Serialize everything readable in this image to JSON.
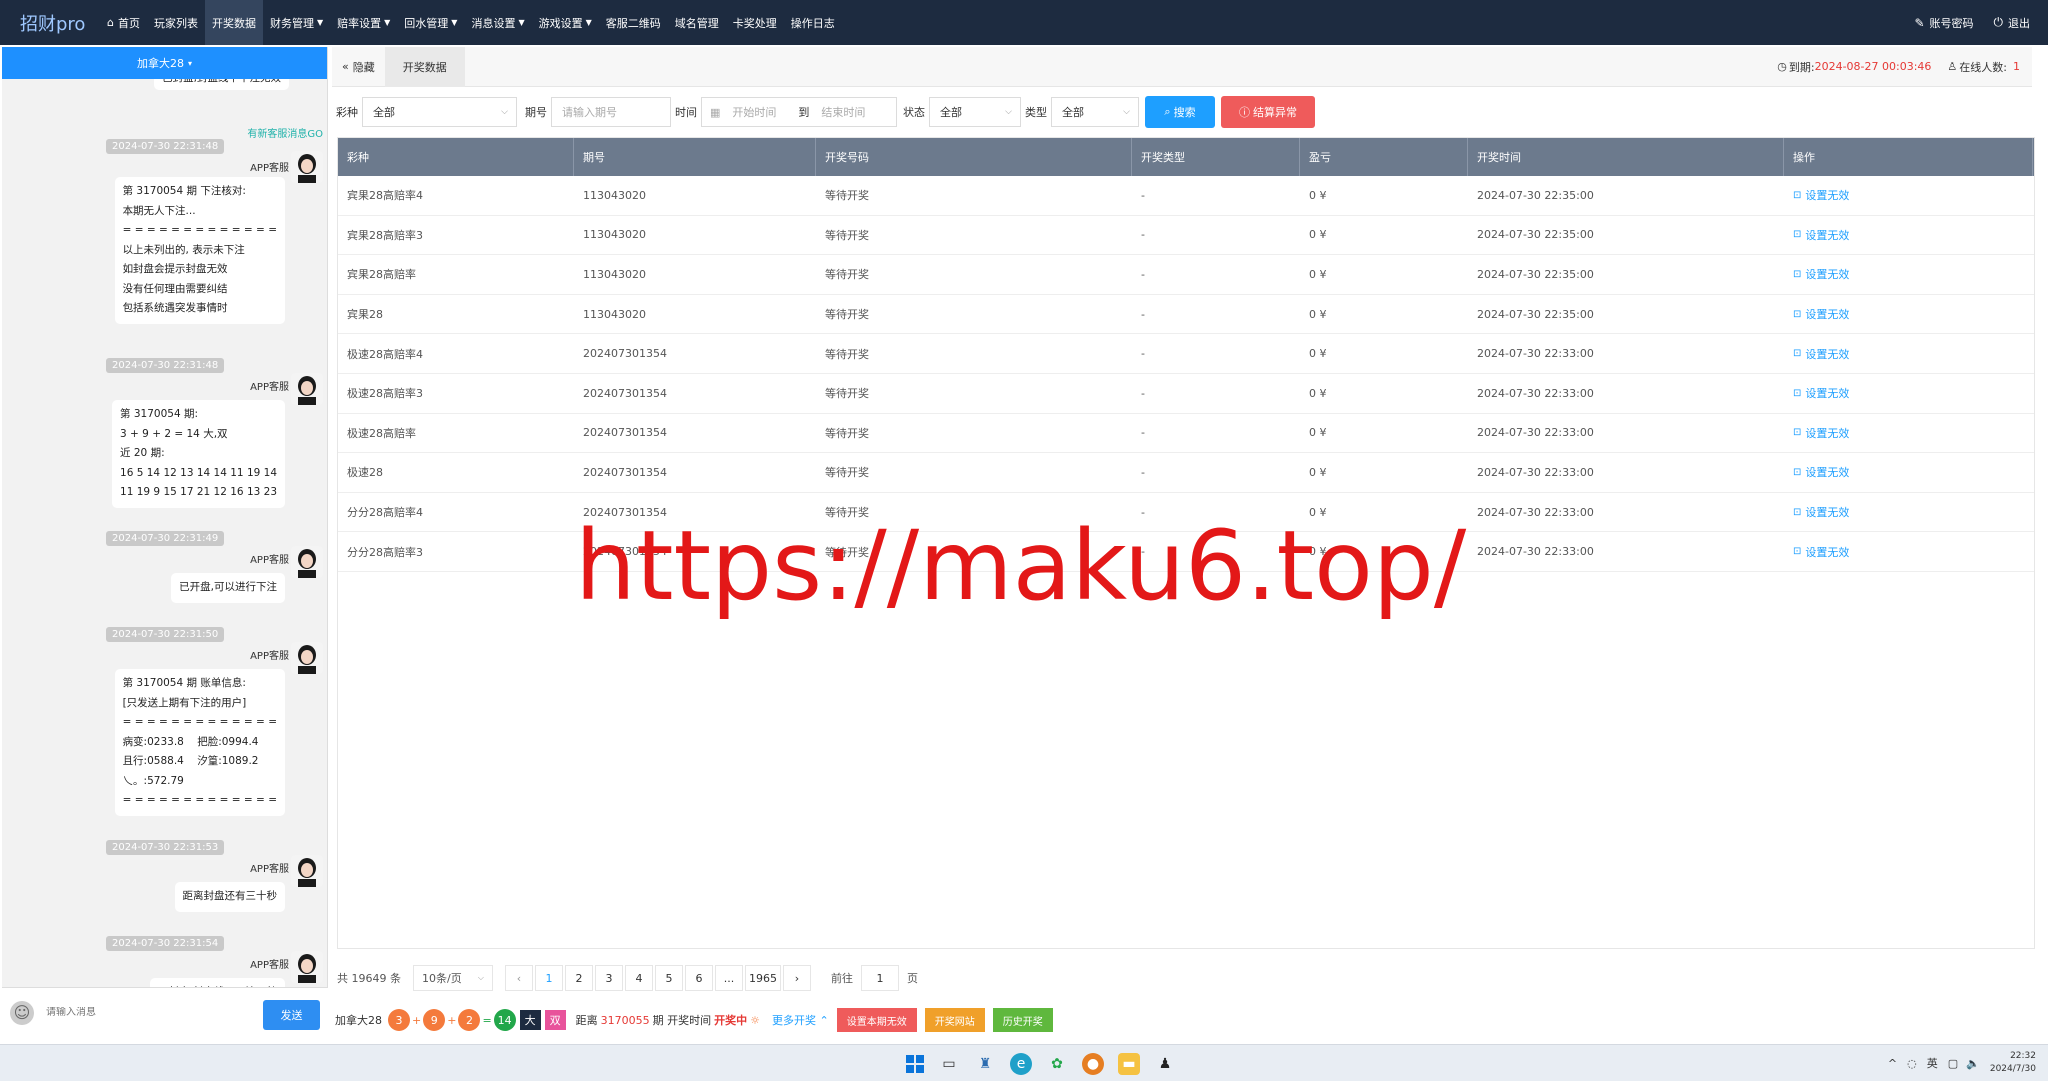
{
  "app": {
    "brand": "招财pro"
  },
  "nav": [
    {
      "label": "首页",
      "icon": "home-icon",
      "caret": false,
      "active": false
    },
    {
      "label": "玩家列表",
      "caret": false,
      "active": false
    },
    {
      "label": "开奖数据",
      "caret": false,
      "active": true
    },
    {
      "label": "财务管理",
      "caret": true,
      "active": false
    },
    {
      "label": "赔率设置",
      "caret": true,
      "active": false
    },
    {
      "label": "回水管理",
      "caret": true,
      "active": false
    },
    {
      "label": "消息设置",
      "caret": true,
      "active": false
    },
    {
      "label": "游戏设置",
      "caret": true,
      "active": false
    },
    {
      "label": "客服二维码",
      "caret": false,
      "active": false
    },
    {
      "label": "域名管理",
      "caret": false,
      "active": false
    },
    {
      "label": "卡奖处理",
      "caret": false,
      "active": false
    },
    {
      "label": "操作日志",
      "caret": false,
      "active": false
    }
  ],
  "top_right": {
    "password_label": "账号密码",
    "logout_label": "退出"
  },
  "chat": {
    "header": "加拿大28",
    "top_partial": "已封盘,封盘线下下注无效",
    "notice": "有新客服消息GO",
    "messages": [
      {
        "time": "2024-07-30 22:31:48",
        "sender": "APP客服",
        "text": "第 3170054 期 下注核对:\n本期无人下注...\n= = = = = = = = = = = = =\n以上未列出的, 表示未下注\n如封盘会提示封盘无效\n没有任何理由需要纠结\n包括系统遇突发事情时"
      },
      {
        "time": "2024-07-30 22:31:48",
        "sender": "APP客服",
        "text": "第 3170054 期:\n3 + 9 + 2 = 14 大,双\n近 20 期:\n16 5 14 12 13 14 14 11 19 14\n11 19 9 15 17 21 12 16 13 23"
      },
      {
        "time": "2024-07-30 22:31:49",
        "sender": "APP客服",
        "text": "已开盘,可以进行下注"
      },
      {
        "time": "2024-07-30 22:31:50",
        "sender": "APP客服",
        "text": "第 3170054 期 账单信息:\n[只发送上期有下注的用户]\n= = = = = = = = = = = = =\n病变:0233.8    把脸:0994.4\n且行:0588.4    汐篁:1089.2\n乀。:572.79\n= = = = = = = = = = = = ="
      },
      {
        "time": "2024-07-30 22:31:53",
        "sender": "APP客服",
        "text": "距离封盘还有三十秒"
      },
      {
        "time": "2024-07-30 22:31:54",
        "sender": "APP客服",
        "text": "已封盘,封盘线下下注无效"
      }
    ],
    "input_placeholder": "请输入消息",
    "send_label": "发送"
  },
  "tabs": {
    "hide_label": "隐藏",
    "current_tab": "开奖数据"
  },
  "expiry": {
    "label": "到期:",
    "value": "2024-08-27 00:03:46",
    "online_label": "在线人数:",
    "online_value": "1"
  },
  "filters": {
    "lottery_label": "彩种",
    "lottery_value": "全部",
    "period_label": "期号",
    "period_placeholder": "请输入期号",
    "time_label": "时间",
    "start_placeholder": "开始时间",
    "to_label": "到",
    "end_placeholder": "结束时间",
    "status_label": "状态",
    "status_value": "全部",
    "type_label": "类型",
    "type_value": "全部",
    "search_label": "搜索",
    "exception_label": "结算异常"
  },
  "table": {
    "columns": [
      "彩种",
      "期号",
      "开奖号码",
      "开奖类型",
      "盈亏",
      "开奖时间",
      "操作"
    ],
    "rows": [
      [
        "宾果28高赔率4",
        "113043020",
        "等待开奖",
        "-",
        "0 ¥",
        "2024-07-30 22:35:00",
        "设置无效"
      ],
      [
        "宾果28高赔率3",
        "113043020",
        "等待开奖",
        "-",
        "0 ¥",
        "2024-07-30 22:35:00",
        "设置无效"
      ],
      [
        "宾果28高赔率",
        "113043020",
        "等待开奖",
        "-",
        "0 ¥",
        "2024-07-30 22:35:00",
        "设置无效"
      ],
      [
        "宾果28",
        "113043020",
        "等待开奖",
        "-",
        "0 ¥",
        "2024-07-30 22:35:00",
        "设置无效"
      ],
      [
        "极速28高赔率4",
        "202407301354",
        "等待开奖",
        "-",
        "0 ¥",
        "2024-07-30 22:33:00",
        "设置无效"
      ],
      [
        "极速28高赔率3",
        "202407301354",
        "等待开奖",
        "-",
        "0 ¥",
        "2024-07-30 22:33:00",
        "设置无效"
      ],
      [
        "极速28高赔率",
        "202407301354",
        "等待开奖",
        "-",
        "0 ¥",
        "2024-07-30 22:33:00",
        "设置无效"
      ],
      [
        "极速28",
        "202407301354",
        "等待开奖",
        "-",
        "0 ¥",
        "2024-07-30 22:33:00",
        "设置无效"
      ],
      [
        "分分28高赔率4",
        "202407301354",
        "等待开奖",
        "-",
        "0 ¥",
        "2024-07-30 22:33:00",
        "设置无效"
      ],
      [
        "分分28高赔率3",
        "202407301354",
        "等待开奖",
        "-",
        "0 ¥",
        "2024-07-30 22:33:00",
        "设置无效"
      ]
    ]
  },
  "pager": {
    "total": "共 19649 条",
    "page_size": "10条/页",
    "pages": [
      "1",
      "2",
      "3",
      "4",
      "5",
      "6",
      "...",
      "1965"
    ],
    "goto_label": "前往",
    "goto_value": "1",
    "page_suffix": "页"
  },
  "status": {
    "game": "加拿大28",
    "n1": "3",
    "n2": "9",
    "n3": "2",
    "sum": "14",
    "size": "大",
    "parity": "双",
    "period_prefix": "距离",
    "period": "3170055",
    "period_suffix": "期 开奖时间",
    "state": "开奖中",
    "more_label": "更多开奖",
    "btn_invalid": "设置本期无效",
    "btn_site": "开奖网站",
    "btn_history": "历史开奖"
  },
  "watermark": "https://maku6.top/",
  "taskbar": {
    "ime": "英",
    "time": "22:32",
    "date": "2024/7/30"
  },
  "colors": {
    "topbar": "#1d2b40",
    "accent": "#1e9fff",
    "danger": "#ef5b5b",
    "header_row": "#6c7a8d"
  }
}
